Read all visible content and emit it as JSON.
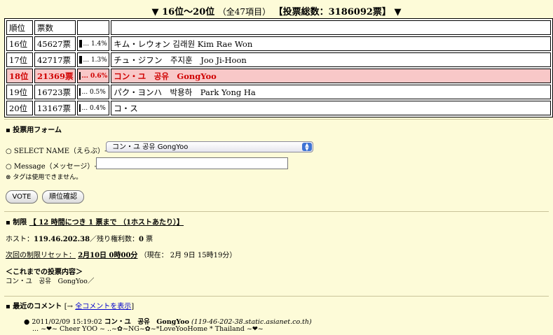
{
  "header": {
    "title": "▼ 16位〜20位",
    "total_items": "（全47項目）",
    "vote_total": "【投票総数：3186092票】 ▼"
  },
  "rank_table": {
    "headers": [
      "順位",
      "票数",
      "",
      ""
    ],
    "rows": [
      {
        "rank": "16位",
        "votes": "45627票",
        "pct": "1.4%",
        "pct_value": 1.4,
        "name": "キム・レウォン 김래원 Kim Rae Won",
        "highlight": false
      },
      {
        "rank": "17位",
        "votes": "42717票",
        "pct": "1.3%",
        "pct_value": 1.3,
        "name": "チュ・ジフン　주지훈　Joo Ji-Hoon",
        "highlight": false
      },
      {
        "rank": "18位",
        "votes": "21369票",
        "pct": "0.6%",
        "pct_value": 0.6,
        "name": "コン・ユ　공유　GongYoo",
        "highlight": true
      },
      {
        "rank": "19位",
        "votes": "16723票",
        "pct": "0.5%",
        "pct_value": 0.5,
        "name": "パク・ヨンハ　박용하　Park Yong Ha",
        "highlight": false
      },
      {
        "rank": "20位",
        "votes": "13167票",
        "pct": "0.4%",
        "pct_value": 0.4,
        "name": "コ・ス",
        "highlight": false
      }
    ]
  },
  "form": {
    "section_title": "投票用フォーム",
    "select_label": "○ SELECT NAME（えらぶ）→",
    "select_value": "コン・ユ 공유 GongYoo",
    "message_label": "○ Message（メッセージ）→",
    "message_value": "",
    "tag_note": "⊗ タグは使用できません。",
    "vote_button": "VOTE",
    "rank_button": "順位確認"
  },
  "limit": {
    "title": "制限",
    "rule": "【 12 時間につき 1 票まで （1ホストあたり）】",
    "host_label": "ホスト：",
    "host_value": "119.46.202.38",
    "remain_label": "／残り権利数：",
    "remain_value": "0",
    "remain_unit": " 票",
    "reset_label": "次回の制限リセット：",
    "reset_value": "2月10日 0時00分",
    "now_text": "（現在： 2月 9日 15時19分）",
    "history_title": "＜これまでの投票内容＞",
    "history_value": "コン・ユ　공유　GongYoo／"
  },
  "comments": {
    "title": "最近のコメント",
    "link_prefix": "[→ ",
    "link_text": "全コメントを表示",
    "link_suffix": "]",
    "items": [
      {
        "datetime": "2011/02/09 15:19:02",
        "name": "コン・ユ　공유　GongYoo",
        "host": "(119-46-202-38.static.asianet.co.th)",
        "text": "... ~❤~ Cheer YOO ~ ..~✿~NG~✿~*LoveYooHome * Thailand ~❤~"
      }
    ]
  }
}
